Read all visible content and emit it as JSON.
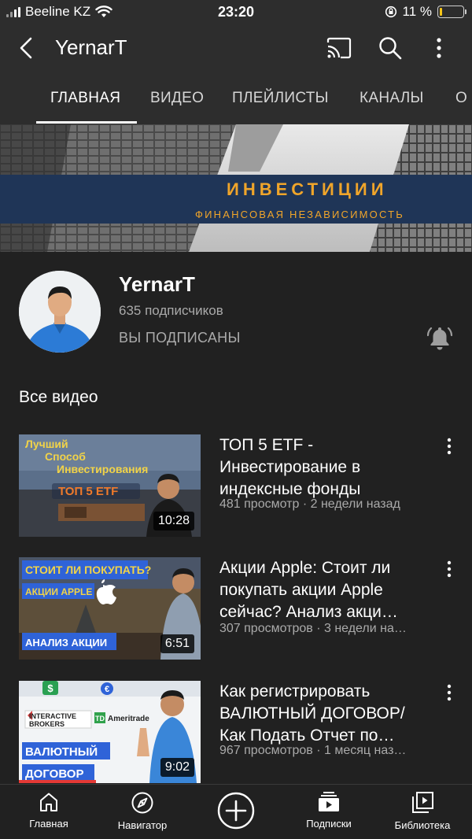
{
  "status": {
    "carrier": "Beeline KZ",
    "time": "23:20",
    "battery": "11 %",
    "battery_level": 0.11,
    "battery_color": "#f5c518"
  },
  "header": {
    "title": "YernarT",
    "icons": [
      "back-icon",
      "cast-icon",
      "search-icon",
      "more-vertical-icon"
    ]
  },
  "tabs": [
    {
      "label": "ГЛАВНАЯ",
      "active": true
    },
    {
      "label": "ВИДЕО",
      "active": false
    },
    {
      "label": "ПЛЕЙЛИСТЫ",
      "active": false
    },
    {
      "label": "КАНАЛЫ",
      "active": false
    },
    {
      "label": "О К",
      "active": false
    }
  ],
  "banner": {
    "title": "ИНВЕСТИЦИИ",
    "subtitle": "ФИНАНСОВАЯ НЕЗАВИСИМОСТЬ"
  },
  "channel": {
    "name": "YernarT",
    "subscribers": "635 подписчиков",
    "subscribed": "ВЫ ПОДПИСАНЫ"
  },
  "section_title": "Все видео",
  "videos": [
    {
      "title_lines": [
        "ТОП 5 ETF -",
        "Инвестирование в",
        "индексные фонды"
      ],
      "meta": "481 просмотр · 2 недели назад",
      "duration": "10:28",
      "thumb_text": [
        "Лучший",
        "Способ",
        "Инвестирования",
        "ТОП 5 ETF"
      ]
    },
    {
      "title_lines": [
        "Акции Apple: Стоит ли",
        "покупать акции Apple",
        "сейчас? Анализ акци…"
      ],
      "meta": "307 просмотров · 3 недели на…",
      "duration": "6:51",
      "thumb_text": [
        "СТОИТ ЛИ ПОКУПАТЬ?",
        "АКЦИИ APPLE",
        "АНАЛИЗ АКЦИИ"
      ]
    },
    {
      "title_lines": [
        "Как регистрировать",
        "ВАЛЮТНЫЙ ДОГОВОР/",
        "Как Подать Отчет по…"
      ],
      "meta": "967 просмотров · 1 месяц наз…",
      "duration": "9:02",
      "thumb_text": [
        "INTERACTIVE",
        "BROKERS",
        "TD",
        "Ameritrade",
        "ВАЛЮТНЫЙ",
        "ДОГОВОР"
      ]
    }
  ],
  "bottom_nav": [
    {
      "label": "Главная",
      "icon": "home-icon"
    },
    {
      "label": "Навигатор",
      "icon": "compass-icon"
    },
    {
      "label": "",
      "icon": "add-icon"
    },
    {
      "label": "Подписки",
      "icon": "subscriptions-icon"
    },
    {
      "label": "Библиотека",
      "icon": "library-icon"
    }
  ]
}
